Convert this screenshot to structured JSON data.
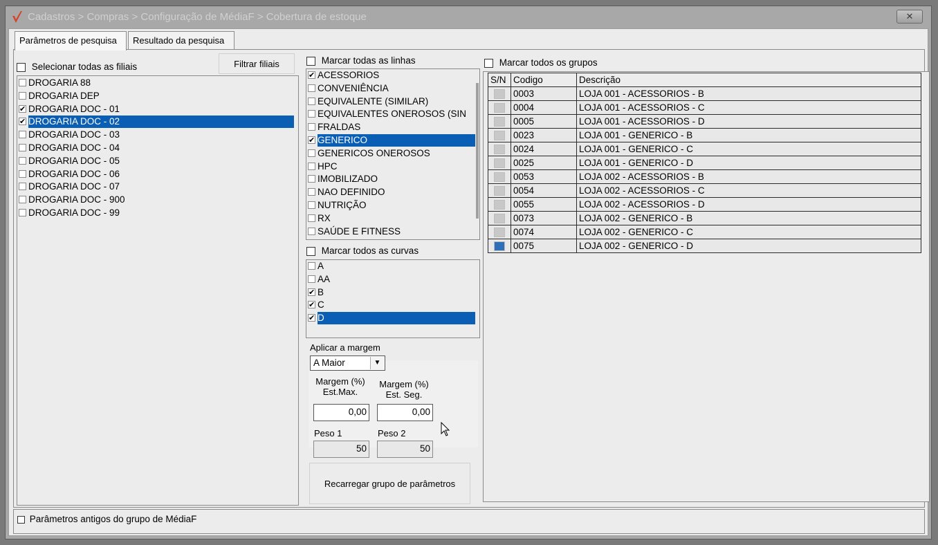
{
  "window": {
    "title": "Cadastros > Compras > Configuração de MédiaF > Cobertura de estoque",
    "close_glyph": "✕"
  },
  "tabs": [
    {
      "label": "Parâmetros de pesquisa",
      "active": true
    },
    {
      "label": "Resultado da pesquisa",
      "active": false
    }
  ],
  "filiais": {
    "select_all_label": "Selecionar todas as filiais",
    "select_all_checked": false,
    "filter_button_label": "Filtrar filiais",
    "items": [
      {
        "label": "DROGARIA 88",
        "checked": false,
        "selected": false
      },
      {
        "label": "DROGARIA DEP",
        "checked": false,
        "selected": false
      },
      {
        "label": "DROGARIA DOC - 01",
        "checked": true,
        "selected": false
      },
      {
        "label": "DROGARIA DOC - 02",
        "checked": true,
        "selected": true
      },
      {
        "label": "DROGARIA DOC - 03",
        "checked": false,
        "selected": false
      },
      {
        "label": "DROGARIA DOC - 04",
        "checked": false,
        "selected": false
      },
      {
        "label": "DROGARIA DOC - 05",
        "checked": false,
        "selected": false
      },
      {
        "label": "DROGARIA DOC - 06",
        "checked": false,
        "selected": false
      },
      {
        "label": "DROGARIA DOC - 07",
        "checked": false,
        "selected": false
      },
      {
        "label": "DROGARIA DOC - 900",
        "checked": false,
        "selected": false
      },
      {
        "label": "DROGARIA DOC - 99",
        "checked": false,
        "selected": false
      }
    ]
  },
  "linhas": {
    "select_all_label": "Marcar todas as linhas",
    "items": [
      {
        "label": "ACESSORIOS",
        "checked": true,
        "selected": false
      },
      {
        "label": "CONVENIÊNCIA",
        "checked": false,
        "selected": false
      },
      {
        "label": "EQUIVALENTE (SIMILAR)",
        "checked": false,
        "selected": false
      },
      {
        "label": "EQUIVALENTES ONEROSOS (SIN",
        "checked": false,
        "selected": false
      },
      {
        "label": "FRALDAS",
        "checked": false,
        "selected": false
      },
      {
        "label": "GENERICO",
        "checked": true,
        "selected": true
      },
      {
        "label": "GENERICOS ONEROSOS",
        "checked": false,
        "selected": false
      },
      {
        "label": "HPC",
        "checked": false,
        "selected": false
      },
      {
        "label": "IMOBILIZADO",
        "checked": false,
        "selected": false
      },
      {
        "label": "NAO DEFINIDO",
        "checked": false,
        "selected": false
      },
      {
        "label": "NUTRIÇÃO",
        "checked": false,
        "selected": false
      },
      {
        "label": "RX",
        "checked": false,
        "selected": false
      },
      {
        "label": "SAÚDE E FITNESS",
        "checked": false,
        "selected": false
      }
    ]
  },
  "curvas": {
    "select_all_label": "Marcar todos as curvas",
    "items": [
      {
        "label": "A",
        "checked": false,
        "selected": false
      },
      {
        "label": "AA",
        "checked": false,
        "selected": false
      },
      {
        "label": "B",
        "checked": true,
        "selected": false
      },
      {
        "label": "C",
        "checked": true,
        "selected": false
      },
      {
        "label": "D",
        "checked": true,
        "selected": true
      }
    ]
  },
  "margem": {
    "apply_label": "Aplicar a margem",
    "apply_value": "A Maior",
    "est_max_label_line1": "Margem (%)",
    "est_max_label_line2": "Est.Max.",
    "est_max_value": "0,00",
    "est_seg_label_line1": "Margem (%)",
    "est_seg_label_line2": "Est. Seg.",
    "est_seg_value": "0,00",
    "peso1_label": "Peso 1",
    "peso1_value": "50",
    "peso2_label": "Peso 2",
    "peso2_value": "50",
    "reload_button_label": "Recarregar grupo de parâmetros"
  },
  "grupos": {
    "select_all_label": "Marcar todos os grupos",
    "columns": [
      "S/N",
      "Codigo",
      "Descrição"
    ],
    "rows": [
      {
        "codigo": "0003",
        "descricao": "LOJA 001 - ACESSORIOS - B",
        "selected": false
      },
      {
        "codigo": "0004",
        "descricao": "LOJA 001 - ACESSORIOS - C",
        "selected": false
      },
      {
        "codigo": "0005",
        "descricao": "LOJA 001 - ACESSORIOS - D",
        "selected": false
      },
      {
        "codigo": "0023",
        "descricao": "LOJA 001 - GENERICO - B",
        "selected": false
      },
      {
        "codigo": "0024",
        "descricao": "LOJA 001 - GENERICO - C",
        "selected": false
      },
      {
        "codigo": "0025",
        "descricao": "LOJA 001 - GENERICO - D",
        "selected": false
      },
      {
        "codigo": "0053",
        "descricao": "LOJA 002 - ACESSORIOS - B",
        "selected": false
      },
      {
        "codigo": "0054",
        "descricao": "LOJA 002 - ACESSORIOS - C",
        "selected": false
      },
      {
        "codigo": "0055",
        "descricao": "LOJA 002 - ACESSORIOS - D",
        "selected": false
      },
      {
        "codigo": "0073",
        "descricao": "LOJA 002 - GENERICO - B",
        "selected": false
      },
      {
        "codigo": "0074",
        "descricao": "LOJA 002 - GENERICO - C",
        "selected": false
      },
      {
        "codigo": "0075",
        "descricao": "LOJA 002 - GENERICO - D",
        "selected": true
      }
    ]
  },
  "footer": {
    "old_params_label": "Parâmetros antigos do grupo de MédiaF",
    "old_params_checked": false
  }
}
